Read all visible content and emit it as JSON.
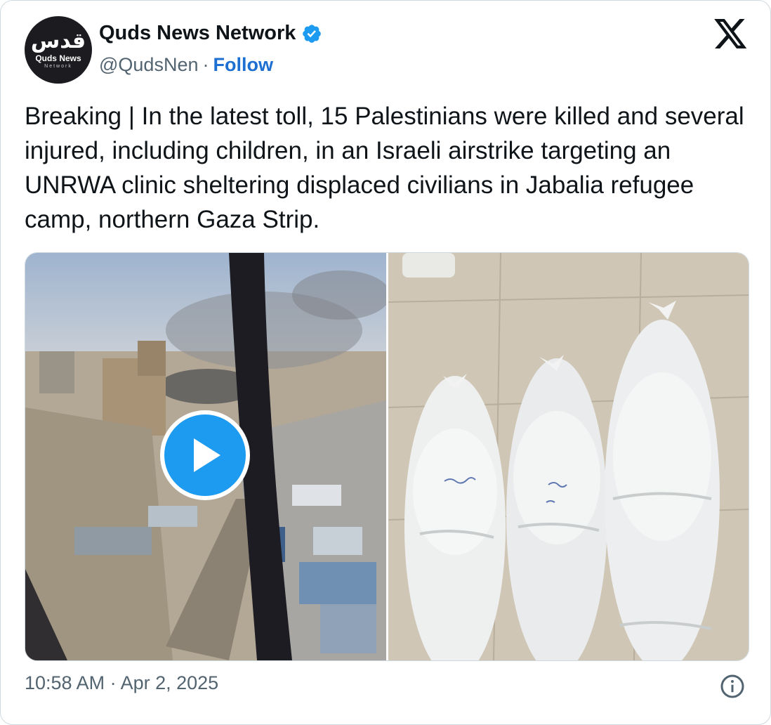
{
  "tweet": {
    "avatar": {
      "logo_ar": "قدس",
      "logo_en": "Quds News",
      "logo_sub": "Network"
    },
    "author": {
      "display_name": "Quds News Network",
      "handle": "@QudsNen",
      "separator": "·",
      "follow_label": "Follow"
    },
    "text": "Breaking | In the latest toll, 15 Palestinians were killed and several injured, including children, in an Israeli airstrike targeting an UNRWA clinic sheltering displaced civilians in Jabalia refugee camp, northern Gaza Strip.",
    "timestamp": "10:58 AM · Apr 2, 2025",
    "media": [
      {
        "kind": "video",
        "icon": "play-icon"
      },
      {
        "kind": "image"
      }
    ],
    "icons": [
      "verified-badge-icon",
      "x-logo-icon",
      "info-icon",
      "play-icon"
    ]
  },
  "colors": {
    "link": "#1d6fd1",
    "verified": "#1d9bf0",
    "play": "#1d9bf0",
    "secondary_text": "#536471",
    "border": "#cfd9de"
  }
}
